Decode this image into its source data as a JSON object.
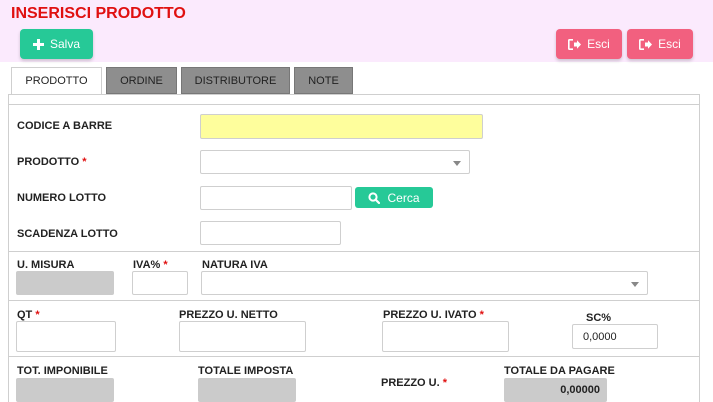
{
  "header": {
    "title": "INSERISCI PRODOTTO"
  },
  "toolbar": {
    "save_label": "Salva",
    "exit_label_1": "Esci",
    "exit_label_2": "Esci"
  },
  "tabs": [
    "PRODOTTO",
    "ORDINE",
    "DISTRIBUTORE",
    "NOTE"
  ],
  "form": {
    "barcode_label": "CODICE A BARRE",
    "product_label": "PRODOTTO",
    "lot_number_label": "NUMERO LOTTO",
    "search_label": "Cerca",
    "lot_expiry_label": "SCADENZA LOTTO",
    "unit_label": "U. MISURA",
    "vat_label": "IVA%",
    "vat_nature_label": "NATURA IVA",
    "qty_label": "QT",
    "net_price_label": "PREZZO U. NETTO",
    "vat_price_label": "PREZZO U. IVATO",
    "discount_label": "SC%",
    "discount_value": "0,0000",
    "taxable_total_label": "TOT. IMPONIBILE",
    "tax_total_label": "TOTALE IMPOSTA",
    "unit_price_label": "PREZZO U.",
    "total_due_label": "TOTALE DA PAGARE",
    "total_due_value": "0,00000",
    "required_mark": "*"
  },
  "colors": {
    "accent_green": "#26c997",
    "exit_pink": "#f2607f",
    "title_red": "#e01010",
    "header_bg": "#fbeafd",
    "barcode_bg": "#fefe9c"
  }
}
